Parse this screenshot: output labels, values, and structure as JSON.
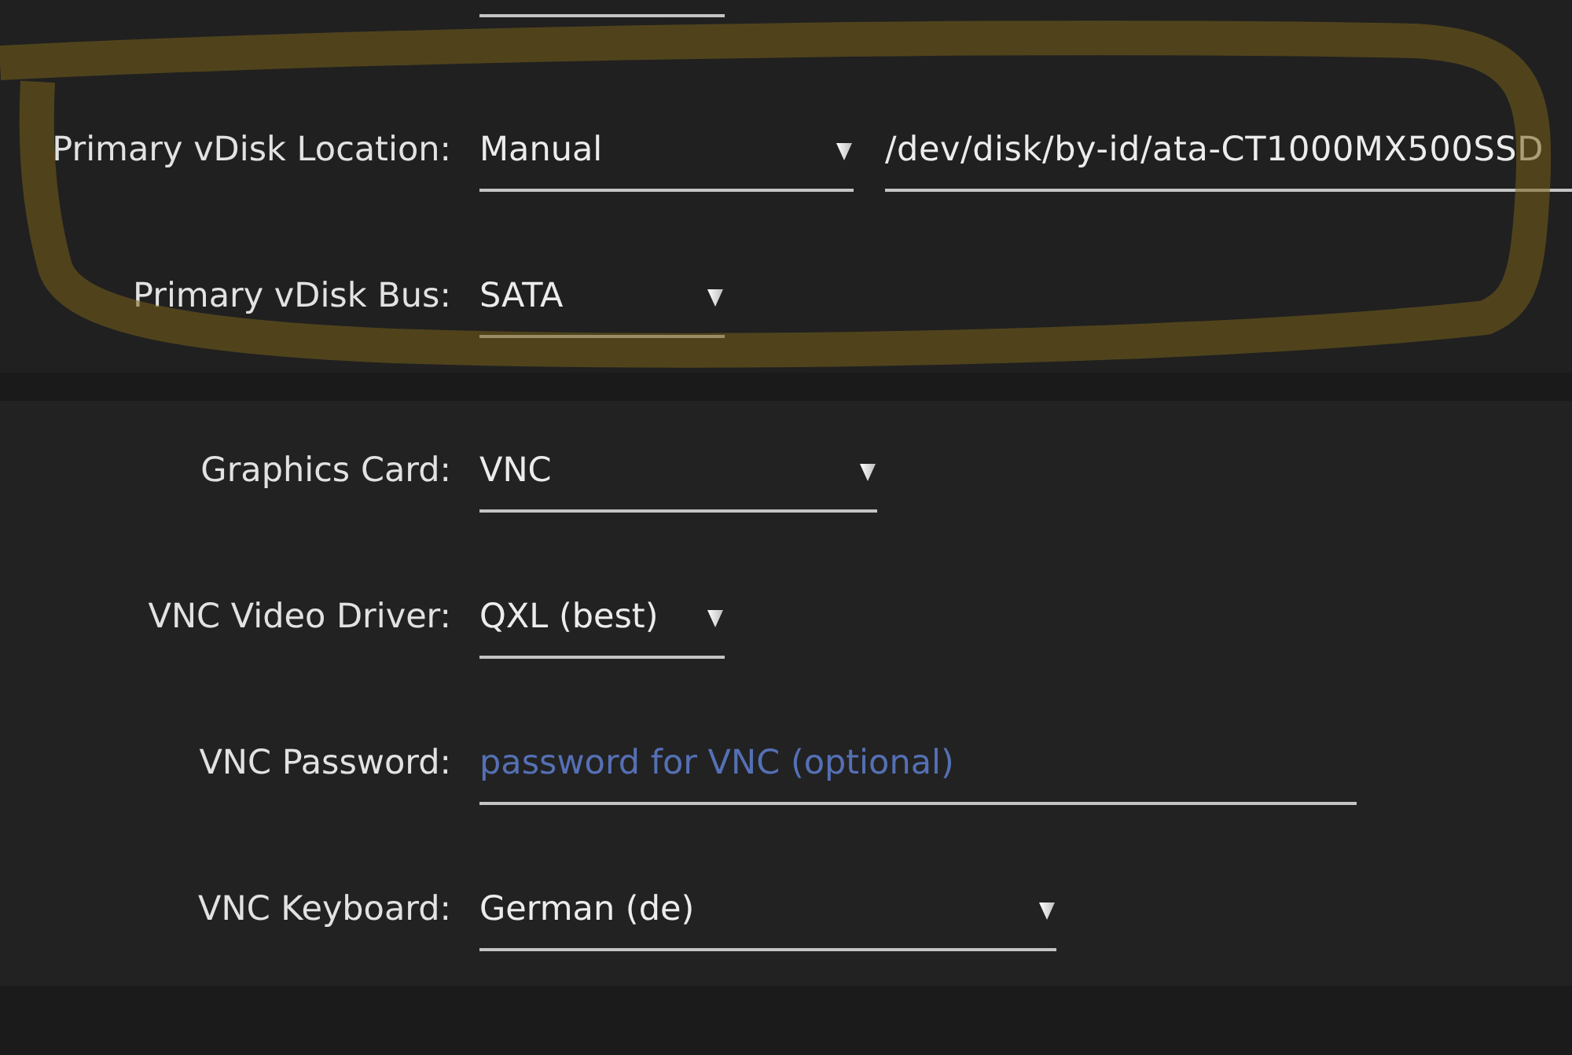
{
  "sections": [
    {
      "rows": [
        {
          "kind": "clipped_field"
        },
        {
          "kind": "field",
          "label": "Primary vDisk Location:",
          "controls": [
            {
              "kind": "select",
              "value": "Manual"
            },
            {
              "kind": "text",
              "value": "/dev/disk/by-id/ata-CT1000MX500SSD"
            }
          ]
        },
        {
          "kind": "field",
          "label": "Primary vDisk Bus:",
          "controls": [
            {
              "kind": "select",
              "value": "SATA"
            }
          ]
        }
      ]
    },
    {
      "rows": [
        {
          "kind": "field",
          "label": "Graphics Card:",
          "controls": [
            {
              "kind": "select",
              "value": "VNC"
            }
          ]
        },
        {
          "kind": "field",
          "label": "VNC Video Driver:",
          "controls": [
            {
              "kind": "select",
              "value": "QXL (best)"
            }
          ]
        },
        {
          "kind": "field",
          "label": "VNC Password:",
          "controls": [
            {
              "kind": "password",
              "placeholder": "password for VNC (optional)"
            }
          ]
        },
        {
          "kind": "field",
          "label": "VNC Keyboard:",
          "controls": [
            {
              "kind": "select",
              "value": "German (de)"
            }
          ]
        }
      ]
    }
  ],
  "annotations": [
    {
      "kind": "freehand_loop"
    }
  ]
}
